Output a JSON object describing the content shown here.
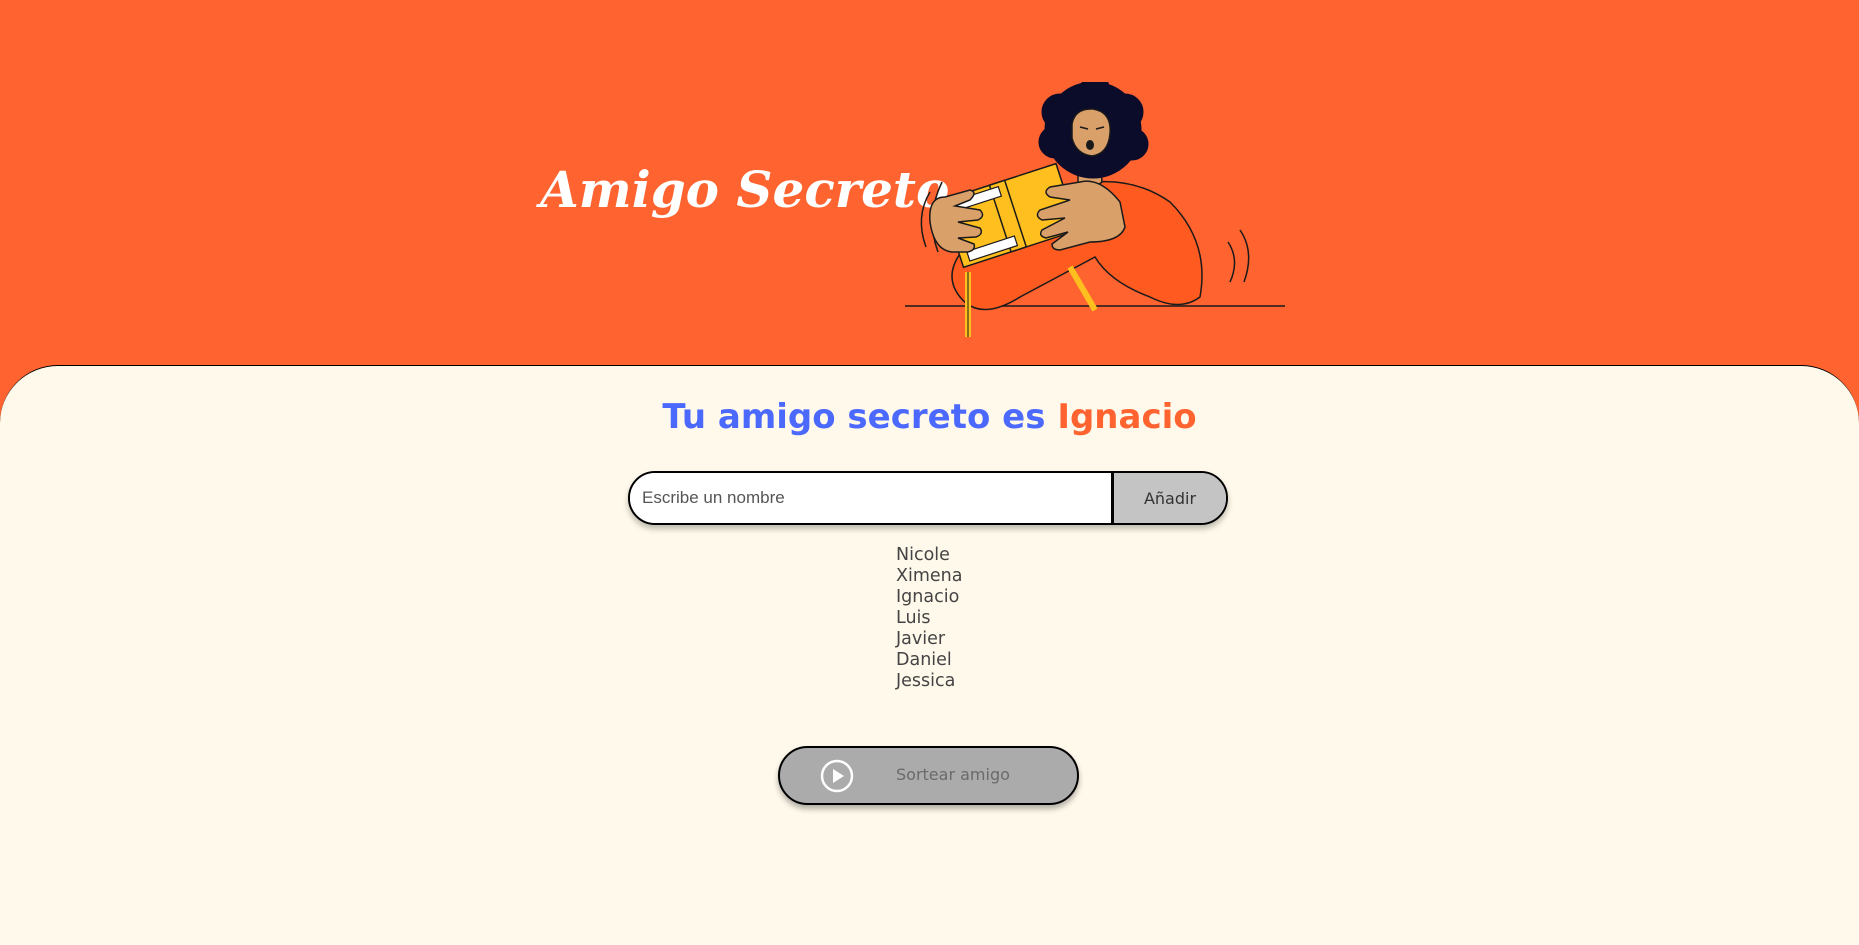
{
  "header": {
    "title": "Amigo Secreto",
    "illustration_icon": "person-with-gift-icon"
  },
  "result": {
    "prefix": "Tu amigo secreto es",
    "winner": "Ignacio"
  },
  "input": {
    "placeholder": "Escribe un nombre",
    "value": ""
  },
  "add_button": {
    "label": "Añadir"
  },
  "friends": [
    "Nicole",
    "Ximena",
    "Ignacio",
    "Luis",
    "Javier",
    "Daniel",
    "Jessica"
  ],
  "draw_button": {
    "label": "Sortear amigo",
    "icon": "play-circle-icon"
  },
  "colors": {
    "header_bg": "#FF6430",
    "main_bg": "#FFF9EB",
    "result_text": "#4B69FD",
    "winner_text": "#FF6430",
    "button_gray": "#C4C4C4",
    "draw_button_bg": "#ABABAB"
  }
}
